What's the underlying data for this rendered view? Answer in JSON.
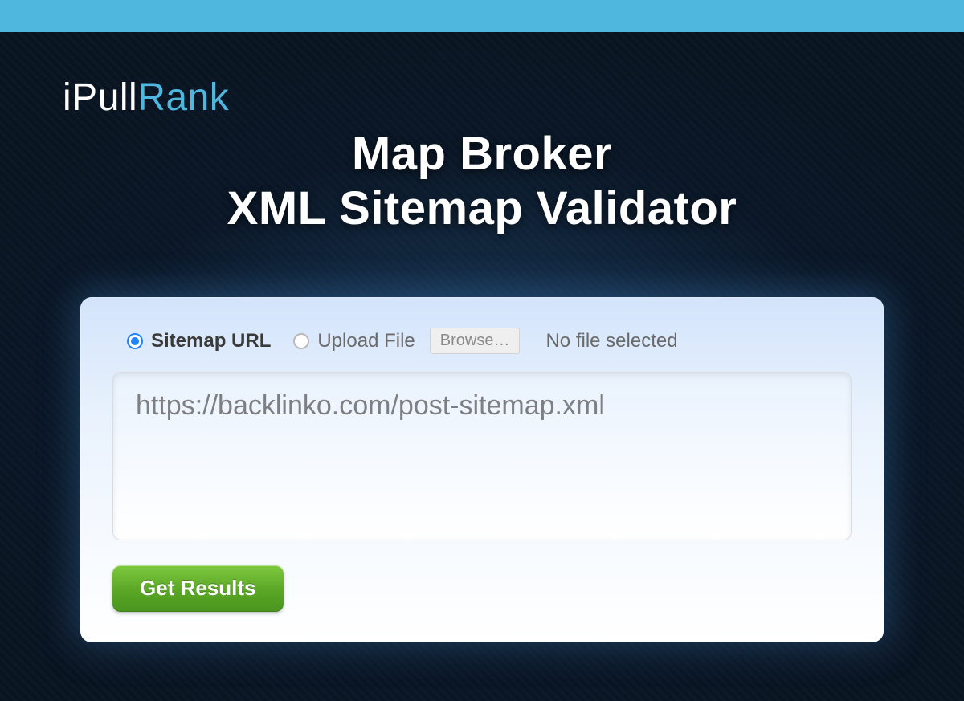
{
  "logo": {
    "part1": "i",
    "part2": "Pull",
    "part3": "Rank"
  },
  "title": {
    "line1": "Map Broker",
    "line2": "XML Sitemap Validator"
  },
  "form": {
    "options": {
      "sitemap_url_label": "Sitemap URL",
      "upload_file_label": "Upload File",
      "browse_label": "Browse…",
      "file_status": "No file selected",
      "selected": "sitemap_url"
    },
    "textarea_value": "https://backlinko.com/post-sitemap.xml",
    "submit_label": "Get Results"
  },
  "colors": {
    "accent_blue": "#4fb6dd",
    "button_green": "#5aa626"
  }
}
